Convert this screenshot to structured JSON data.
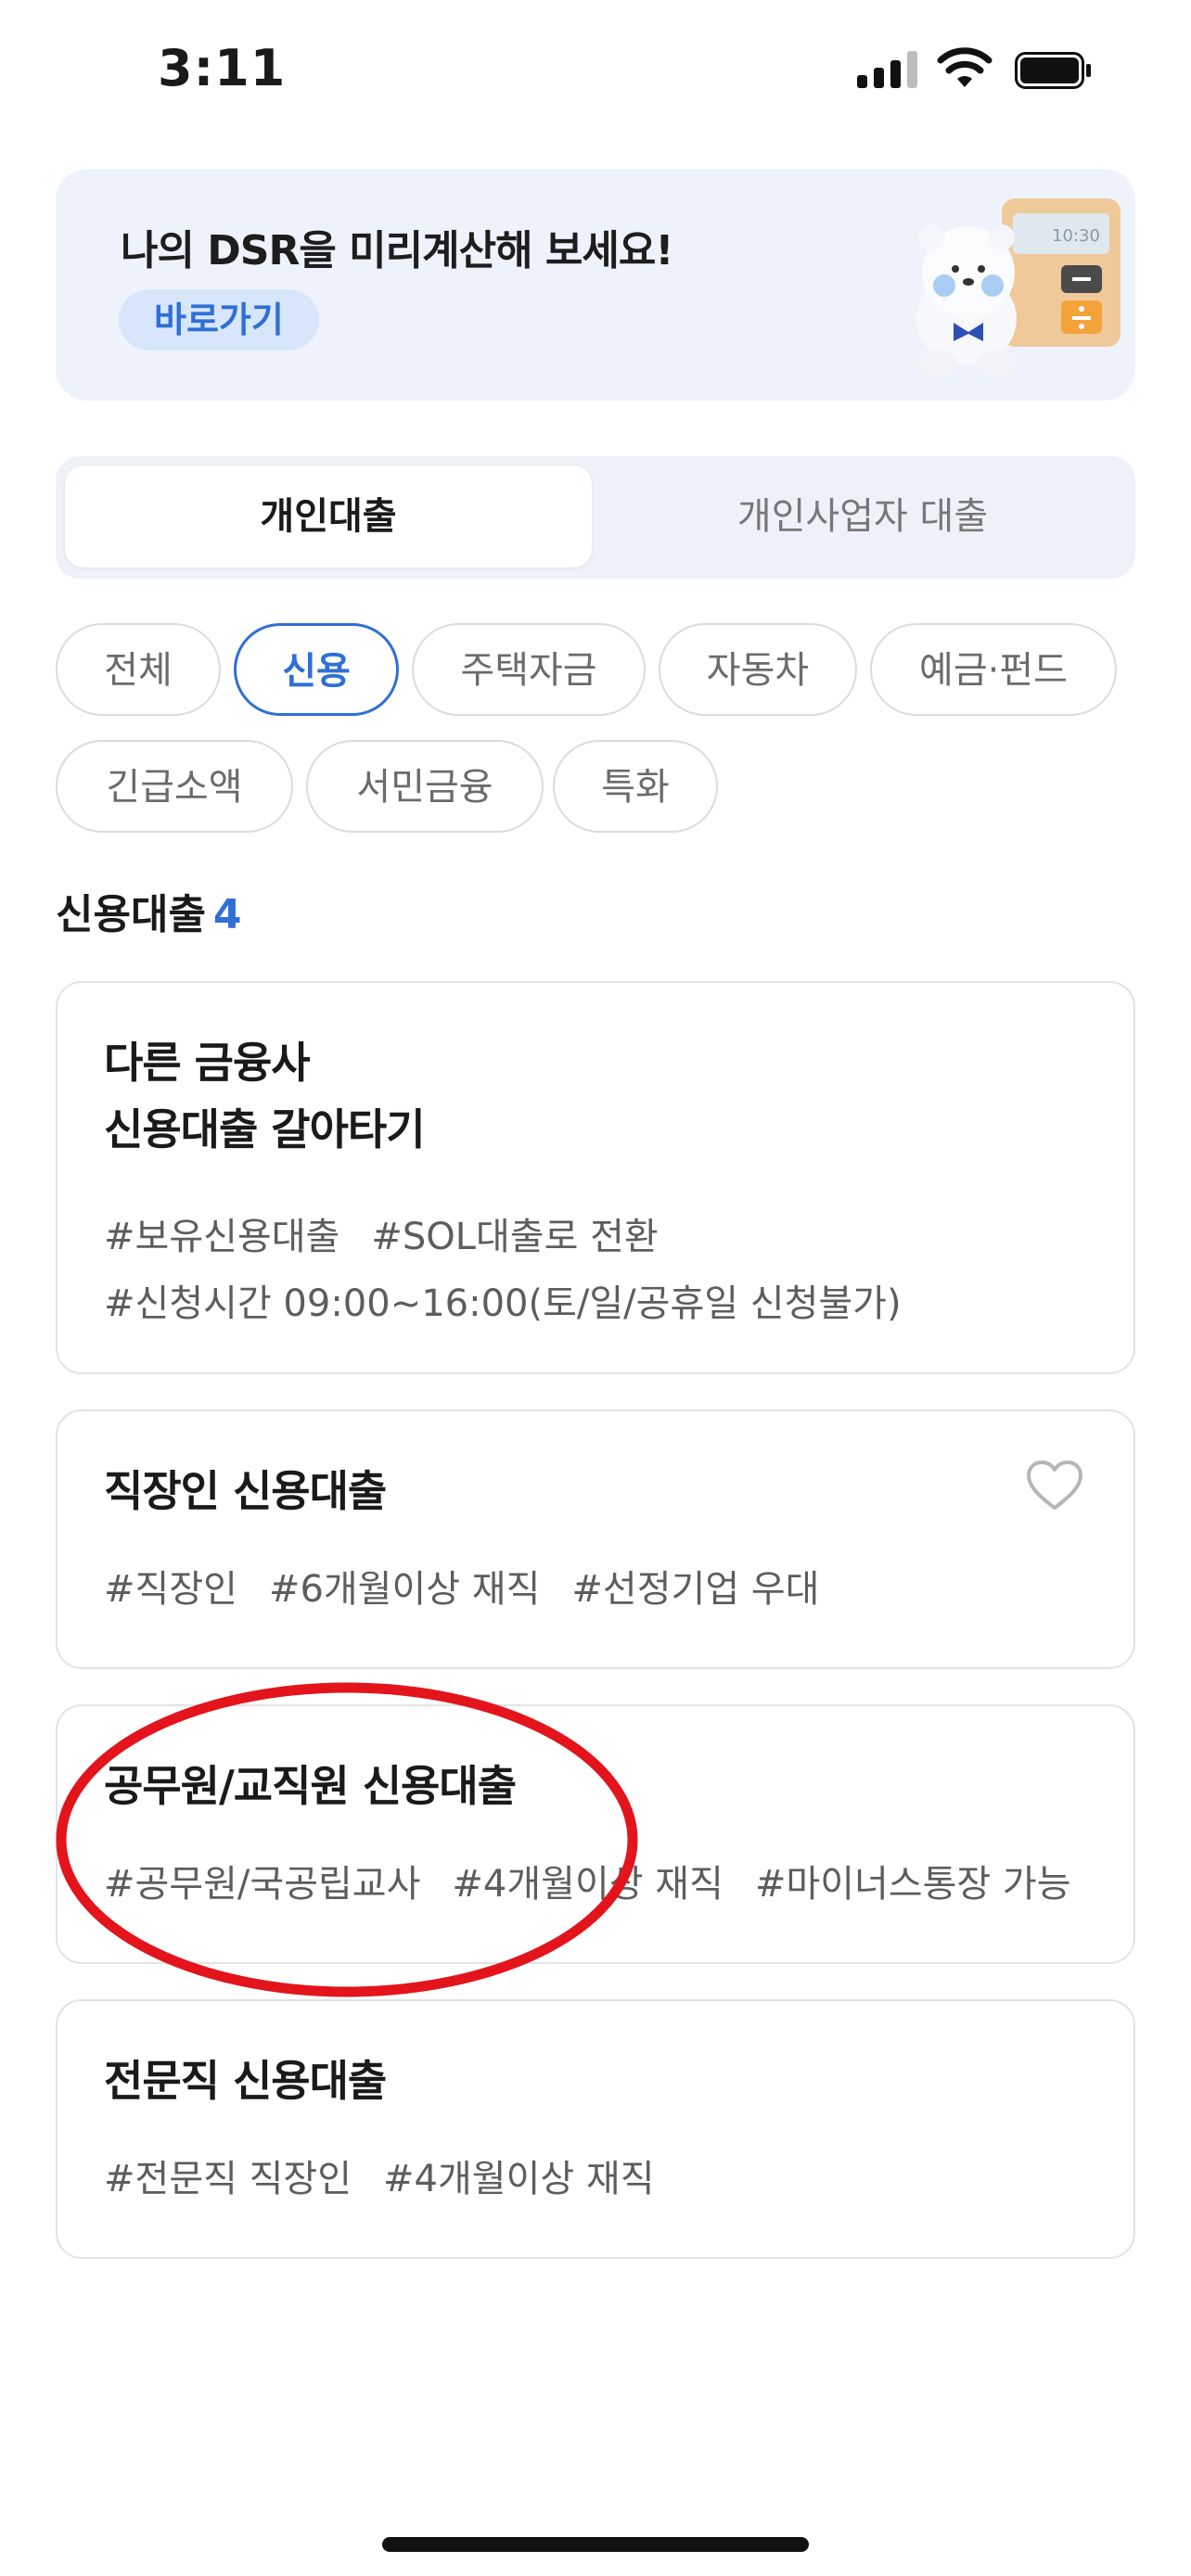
{
  "status_bar": {
    "time": "3:11"
  },
  "banner": {
    "title": "나의 DSR을 미리계산해 보세요!",
    "button_label": "바로가기",
    "calculator_display": "10:30"
  },
  "segment": {
    "tabs": [
      "개인대출",
      "개인사업자 대출"
    ],
    "selected": "개인대출"
  },
  "filters": {
    "chips": [
      "전체",
      "신용",
      "주택자금",
      "자동차",
      "예금·펀드",
      "긴급소액",
      "서민금융",
      "특화"
    ],
    "selected": "신용"
  },
  "section": {
    "title": "신용대출",
    "count": "4"
  },
  "loans": [
    {
      "title_line1": "다른 금융사",
      "title_line2": "신용대출 갈아타기",
      "tags_line1": [
        "#보유신용대출",
        "#SOL대출로 전환"
      ],
      "tags_line2": [
        "#신청시간 09:00~16:00(토/일/공휴일 신청불가)"
      ]
    },
    {
      "title": "직장인 신용대출",
      "tags": [
        "#직장인",
        "#6개월이상 재직",
        "#선정기업 우대"
      ],
      "favorite": false
    },
    {
      "title": "공무원/교직원 신용대출",
      "tags": [
        "#공무원/국공립교사",
        "#4개월이상 재직",
        "#마이너스통장 가능"
      ]
    },
    {
      "title": "전문직 신용대출",
      "tags": [
        "#전문직 직장인",
        "#4개월이상 재직"
      ]
    }
  ],
  "colors": {
    "accent": "#2f6fd6",
    "annotation": "#e3141b",
    "banner_bg": "#eef3fb"
  }
}
